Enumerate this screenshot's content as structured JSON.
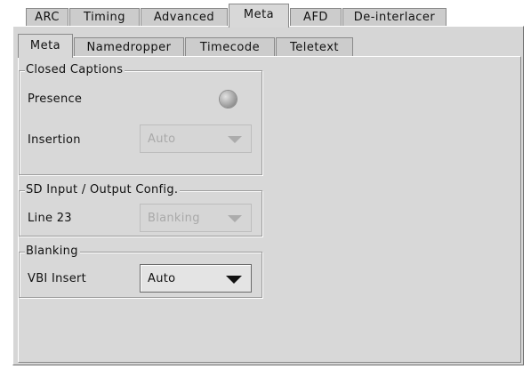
{
  "top_tabs": [
    {
      "label": "ARC",
      "selected": false
    },
    {
      "label": "Timing",
      "selected": false
    },
    {
      "label": "Advanced",
      "selected": false
    },
    {
      "label": "Meta",
      "selected": true
    },
    {
      "label": "AFD",
      "selected": false
    },
    {
      "label": "De-interlacer",
      "selected": false
    }
  ],
  "sub_tabs": [
    {
      "label": "Meta",
      "selected": true
    },
    {
      "label": "Namedropper",
      "selected": false
    },
    {
      "label": "Timecode",
      "selected": false
    },
    {
      "label": "Teletext",
      "selected": false
    }
  ],
  "closed_captions": {
    "title": "Closed Captions",
    "presence_label": "Presence",
    "presence_indicator": "off",
    "insertion_label": "Insertion",
    "insertion_value": "Auto",
    "insertion_enabled": false
  },
  "sd_config": {
    "title": "SD Input / Output Config.",
    "line23_label": "Line 23",
    "line23_value": "Blanking",
    "line23_enabled": false
  },
  "blanking": {
    "title": "Blanking",
    "vbi_insert_label": "VBI Insert",
    "vbi_insert_value": "Auto",
    "vbi_insert_enabled": true
  },
  "colors": {
    "panel": "#d8d8d8",
    "tab": "#cccccc",
    "disabled_text": "#a9a9a9"
  }
}
